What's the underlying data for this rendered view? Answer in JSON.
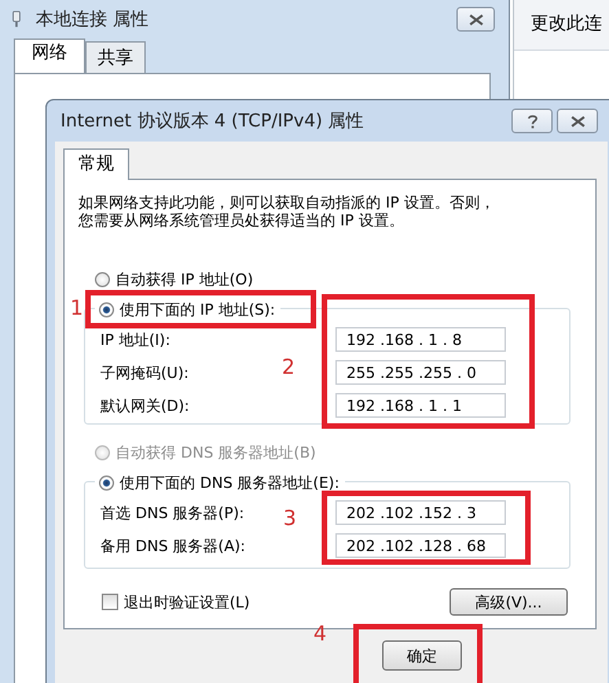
{
  "background_window": {
    "title": "本地连接 属性",
    "tabs": [
      {
        "label": "网络",
        "selected": true
      },
      {
        "label": "共享",
        "selected": false
      }
    ]
  },
  "side_panel": {
    "title": "更改此连"
  },
  "dialog": {
    "title": "Internet 协议版本 4 (TCP/IPv4) 属性",
    "tabs": [
      {
        "label": "常规",
        "selected": true
      }
    ],
    "intro": [
      "如果网络支持此功能，则可以获取自动指派的 IP 设置。否则，",
      "您需要从网络系统管理员处获得适当的 IP 设置。"
    ],
    "ip_mode": [
      {
        "label": "自动获得 IP 地址(O)",
        "selected": false,
        "disabled": false
      },
      {
        "label": "使用下面的 IP 地址(S):",
        "selected": true,
        "disabled": false
      }
    ],
    "ip_fields": [
      {
        "label": "IP 地址(I):",
        "value": "192 .168 . 1 . 8"
      },
      {
        "label": "子网掩码(U):",
        "value": "255 .255 .255 . 0"
      },
      {
        "label": "默认网关(D):",
        "value": "192 .168 . 1 . 1"
      }
    ],
    "dns_mode": [
      {
        "label": "自动获得 DNS 服务器地址(B)",
        "selected": false,
        "disabled": true
      },
      {
        "label": "使用下面的 DNS 服务器地址(E):",
        "selected": true,
        "disabled": false
      }
    ],
    "dns_fields": [
      {
        "label": "首选 DNS 服务器(P):",
        "value": "202 .102 .152 . 3"
      },
      {
        "label": "备用 DNS 服务器(A):",
        "value": "202 .102 .128 . 68"
      }
    ],
    "validate": {
      "label": "退出时验证设置(L)",
      "checked": false
    },
    "advanced_button": "高级(V)...",
    "ok_button": "确定"
  },
  "annotations": [
    {
      "number": "1"
    },
    {
      "number": "2"
    },
    {
      "number": "3"
    },
    {
      "number": "4"
    }
  ]
}
